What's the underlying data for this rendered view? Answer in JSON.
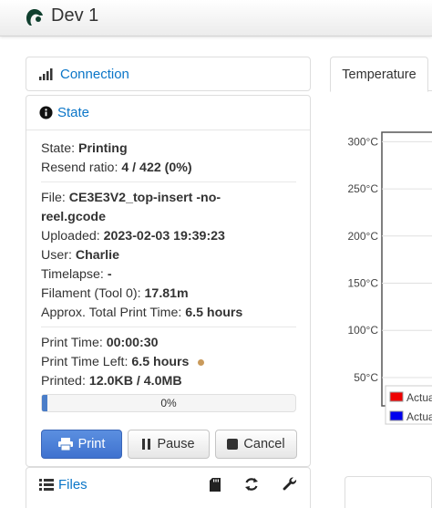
{
  "app": {
    "title": "Dev 1"
  },
  "sidebar": {
    "connection": {
      "label": "Connection",
      "icon": "signal-icon"
    },
    "state": {
      "label": "State",
      "icon": "info-icon",
      "status": {
        "label": "State:",
        "value": "Printing"
      },
      "resend": {
        "label": "Resend ratio:",
        "value": "4 / 422 (0%)"
      },
      "file": {
        "label": "File:",
        "value_line1": "CE3E3V2_top-insert -no-",
        "value_line2": "reel.gcode"
      },
      "uploaded": {
        "label": "Uploaded:",
        "value": "2023-02-03 19:39:23"
      },
      "user": {
        "label": "User:",
        "value": "Charlie"
      },
      "timelapse": {
        "label": "Timelapse:",
        "value": "-"
      },
      "filament": {
        "label": "Filament (Tool 0):",
        "value": "17.81m"
      },
      "approx_time": {
        "label": "Approx. Total Print Time:",
        "value": "6.5 hours"
      },
      "print_time": {
        "label": "Print Time:",
        "value": "00:00:30"
      },
      "time_left": {
        "label": "Print Time Left:",
        "value": "6.5 hours"
      },
      "printed": {
        "label": "Printed:",
        "value": "12.0KB / 4.0MB"
      },
      "progress": {
        "label": "0%",
        "fraction": 0.0
      },
      "buttons": {
        "print": "Print",
        "pause": "Pause",
        "cancel": "Cancel"
      }
    },
    "files": {
      "label": "Files",
      "icons": [
        "sd-card-icon",
        "refresh-icon",
        "wrench-icon"
      ]
    }
  },
  "tabs": {
    "temperature": "Temperature"
  },
  "chart_data": {
    "type": "line",
    "title": "",
    "xlabel": "",
    "ylabel": "",
    "y_ticks": [
      "300°C",
      "250°C",
      "200°C",
      "150°C",
      "100°C",
      "50°C"
    ],
    "y_tick_values": [
      300,
      250,
      200,
      150,
      100,
      50
    ],
    "ylim": [
      20,
      310
    ],
    "series": [
      {
        "name": "Actua",
        "color": "#ee0000"
      },
      {
        "name": "Actua",
        "color": "#0000ee"
      }
    ]
  },
  "colors": {
    "accent": "#0b76c8",
    "print_button": "#4a7dc8",
    "logo": "#11402f"
  }
}
